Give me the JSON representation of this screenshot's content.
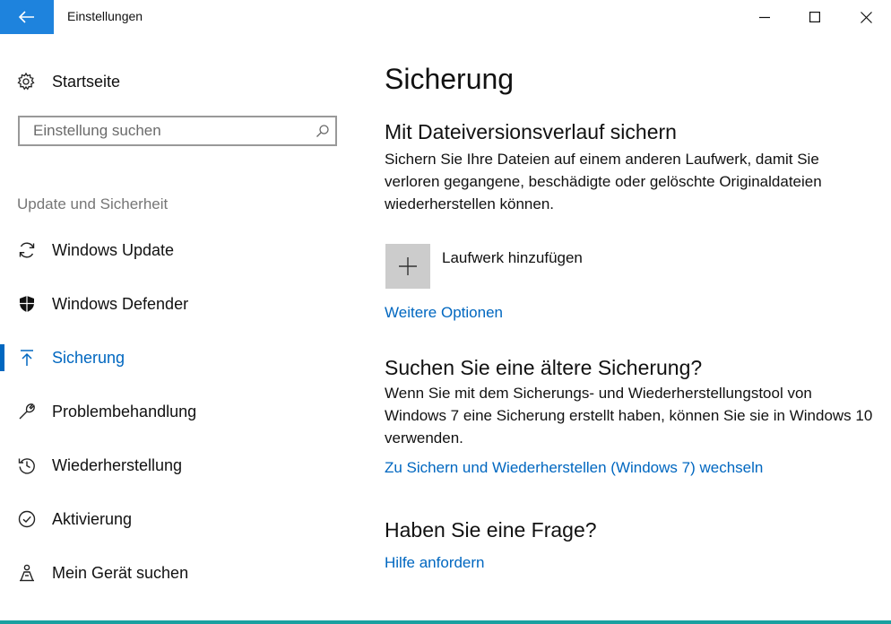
{
  "window": {
    "title": "Einstellungen",
    "accent_color": "#1e83dd",
    "link_color": "#0067c0"
  },
  "sidebar": {
    "home_label": "Startseite",
    "search_placeholder": "Einstellung suchen",
    "section_header": "Update und Sicherheit",
    "items": [
      {
        "label": "Windows Update",
        "icon": "refresh-icon",
        "active": false
      },
      {
        "label": "Windows Defender",
        "icon": "shield-icon",
        "active": false
      },
      {
        "label": "Sicherung",
        "icon": "upload-arrow-icon",
        "active": true
      },
      {
        "label": "Problembehandlung",
        "icon": "wrench-icon",
        "active": false
      },
      {
        "label": "Wiederherstellung",
        "icon": "history-icon",
        "active": false
      },
      {
        "label": "Aktivierung",
        "icon": "check-circle-icon",
        "active": false
      },
      {
        "label": "Mein Gerät suchen",
        "icon": "person-locate-icon",
        "active": false
      }
    ]
  },
  "main": {
    "title": "Sicherung",
    "file_history": {
      "heading": "Mit Dateiversionsverlauf sichern",
      "description": "Sichern Sie Ihre Dateien auf einem anderen Laufwerk, damit Sie verloren gegangene, beschädigte oder gelöschte Originaldateien wiederherstellen können.",
      "add_drive_label": "Laufwerk hinzufügen",
      "more_options_link": "Weitere Optionen"
    },
    "older_backup": {
      "heading": "Suchen Sie eine ältere Sicherung?",
      "description": "Wenn Sie mit dem Sicherungs- und Wiederherstellungstool von Windows 7 eine Sicherung erstellt haben, können Sie sie in Windows 10 verwenden.",
      "link": "Zu Sichern und Wiederherstellen (Windows 7) wechseln"
    },
    "question": {
      "heading": "Haben Sie eine Frage?",
      "link": "Hilfe anfordern"
    }
  }
}
